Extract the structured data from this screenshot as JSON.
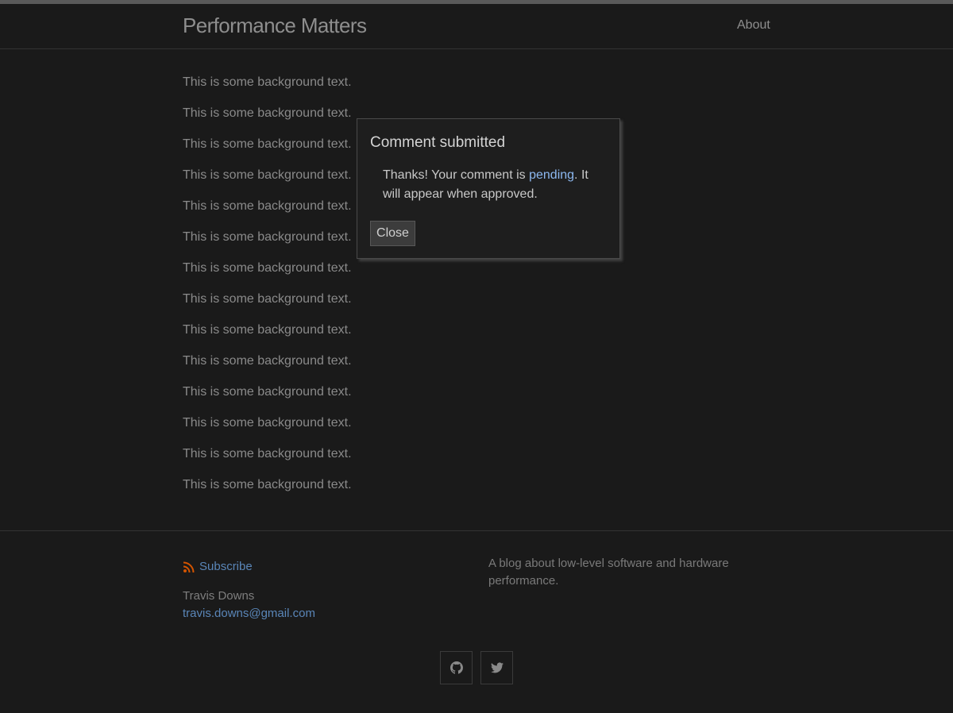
{
  "header": {
    "site_title": "Performance Matters",
    "nav": [
      {
        "label": "About"
      }
    ]
  },
  "content": {
    "lines": [
      "This is some background text.",
      "This is some background text.",
      "This is some background text.",
      "This is some background text.",
      "This is some background text.",
      "This is some background text.",
      "This is some background text.",
      "This is some background text.",
      "This is some background text.",
      "This is some background text.",
      "This is some background text.",
      "This is some background text.",
      "This is some background text.",
      "This is some background text."
    ]
  },
  "modal": {
    "title": "Comment submitted",
    "body_before": "Thanks! Your comment is ",
    "body_link": "pending",
    "body_after": ". It will appear when approved.",
    "close_label": "Close"
  },
  "footer": {
    "subscribe_label": "Subscribe",
    "author_name": "Travis Downs",
    "author_email": "travis.downs@gmail.com",
    "description": "A blog about low-level software and hardware performance.",
    "social": [
      {
        "icon": "github-icon"
      },
      {
        "icon": "twitter-icon"
      }
    ]
  },
  "colors": {
    "background": "#1a1a1a",
    "link": "#5a86b8",
    "pending_link": "#8cb8f0",
    "rss": "#d35400"
  }
}
